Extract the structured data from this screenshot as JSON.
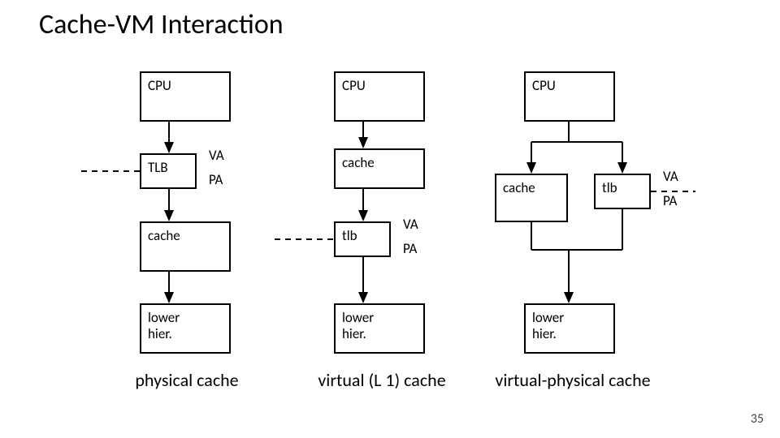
{
  "title": "Cache-VM Interaction",
  "labels": {
    "cpu": "CPU",
    "tlb_upper": "TLB",
    "cache": "cache",
    "tlb_lower": "tlb",
    "lower": "lower\nhier.",
    "va": "VA",
    "pa": "PA"
  },
  "captions": {
    "col1": "physical cache",
    "col2": "virtual (L 1) cache",
    "col3": "virtual-physical cache"
  },
  "slide_number": "35"
}
